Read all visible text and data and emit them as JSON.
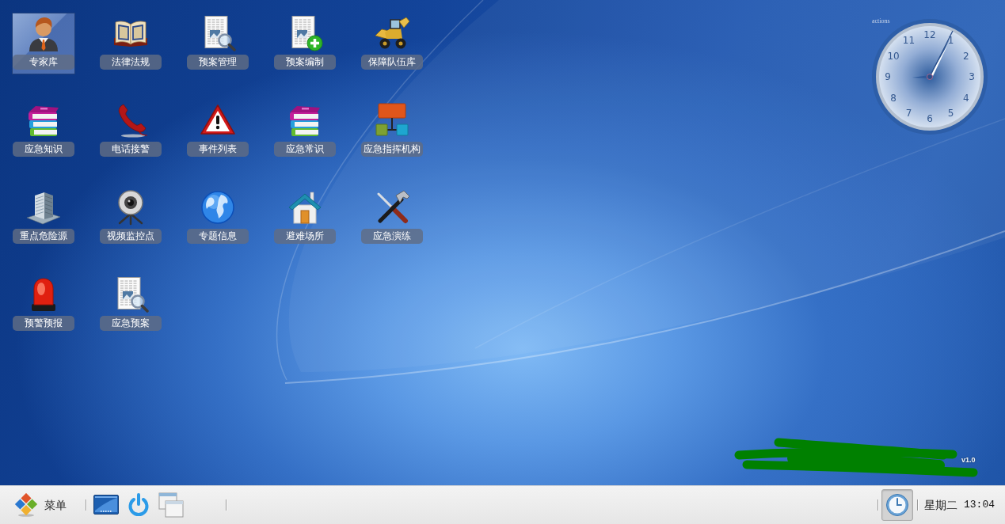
{
  "desktop": {
    "shortcuts": [
      {
        "label": "专家库",
        "kind": "person",
        "selected": true
      },
      {
        "label": "法律法规",
        "kind": "book",
        "selected": false
      },
      {
        "label": "预案管理",
        "kind": "doc-search",
        "selected": false
      },
      {
        "label": "预案编制",
        "kind": "doc-add",
        "selected": false
      },
      {
        "label": "保障队伍库",
        "kind": "loader",
        "selected": false
      },
      {
        "label": "应急知识",
        "kind": "books",
        "selected": false
      },
      {
        "label": "电话接警",
        "kind": "phone",
        "selected": false
      },
      {
        "label": "事件列表",
        "kind": "warning",
        "selected": false
      },
      {
        "label": "应急常识",
        "kind": "books",
        "selected": false
      },
      {
        "label": "应急指挥机构",
        "kind": "org-chart",
        "selected": false
      },
      {
        "label": "重点危险源",
        "kind": "building",
        "selected": false
      },
      {
        "label": "视频监控点",
        "kind": "webcam",
        "selected": false
      },
      {
        "label": "专题信息",
        "kind": "globe",
        "selected": false
      },
      {
        "label": "避难场所",
        "kind": "house",
        "selected": false
      },
      {
        "label": "应急演练",
        "kind": "tools",
        "selected": false
      },
      {
        "label": "预警预报",
        "kind": "siren",
        "selected": false
      },
      {
        "label": "应急预案",
        "kind": "doc-search",
        "selected": false
      }
    ]
  },
  "clock_widget": {
    "caption": "actions",
    "numerals": [
      "12",
      "1",
      "2",
      "3",
      "4",
      "5",
      "6",
      "7",
      "8",
      "9",
      "10",
      "11"
    ]
  },
  "logo": {
    "redacted": true,
    "version": "v1.0"
  },
  "taskbar": {
    "menu_button": {
      "label": "菜单"
    },
    "quick_launch": [
      {
        "kind": "screen"
      },
      {
        "kind": "power"
      },
      {
        "kind": "windows"
      }
    ],
    "clock_button": {
      "pressed": true
    },
    "weekday": "星期二",
    "time": "13:04"
  }
}
